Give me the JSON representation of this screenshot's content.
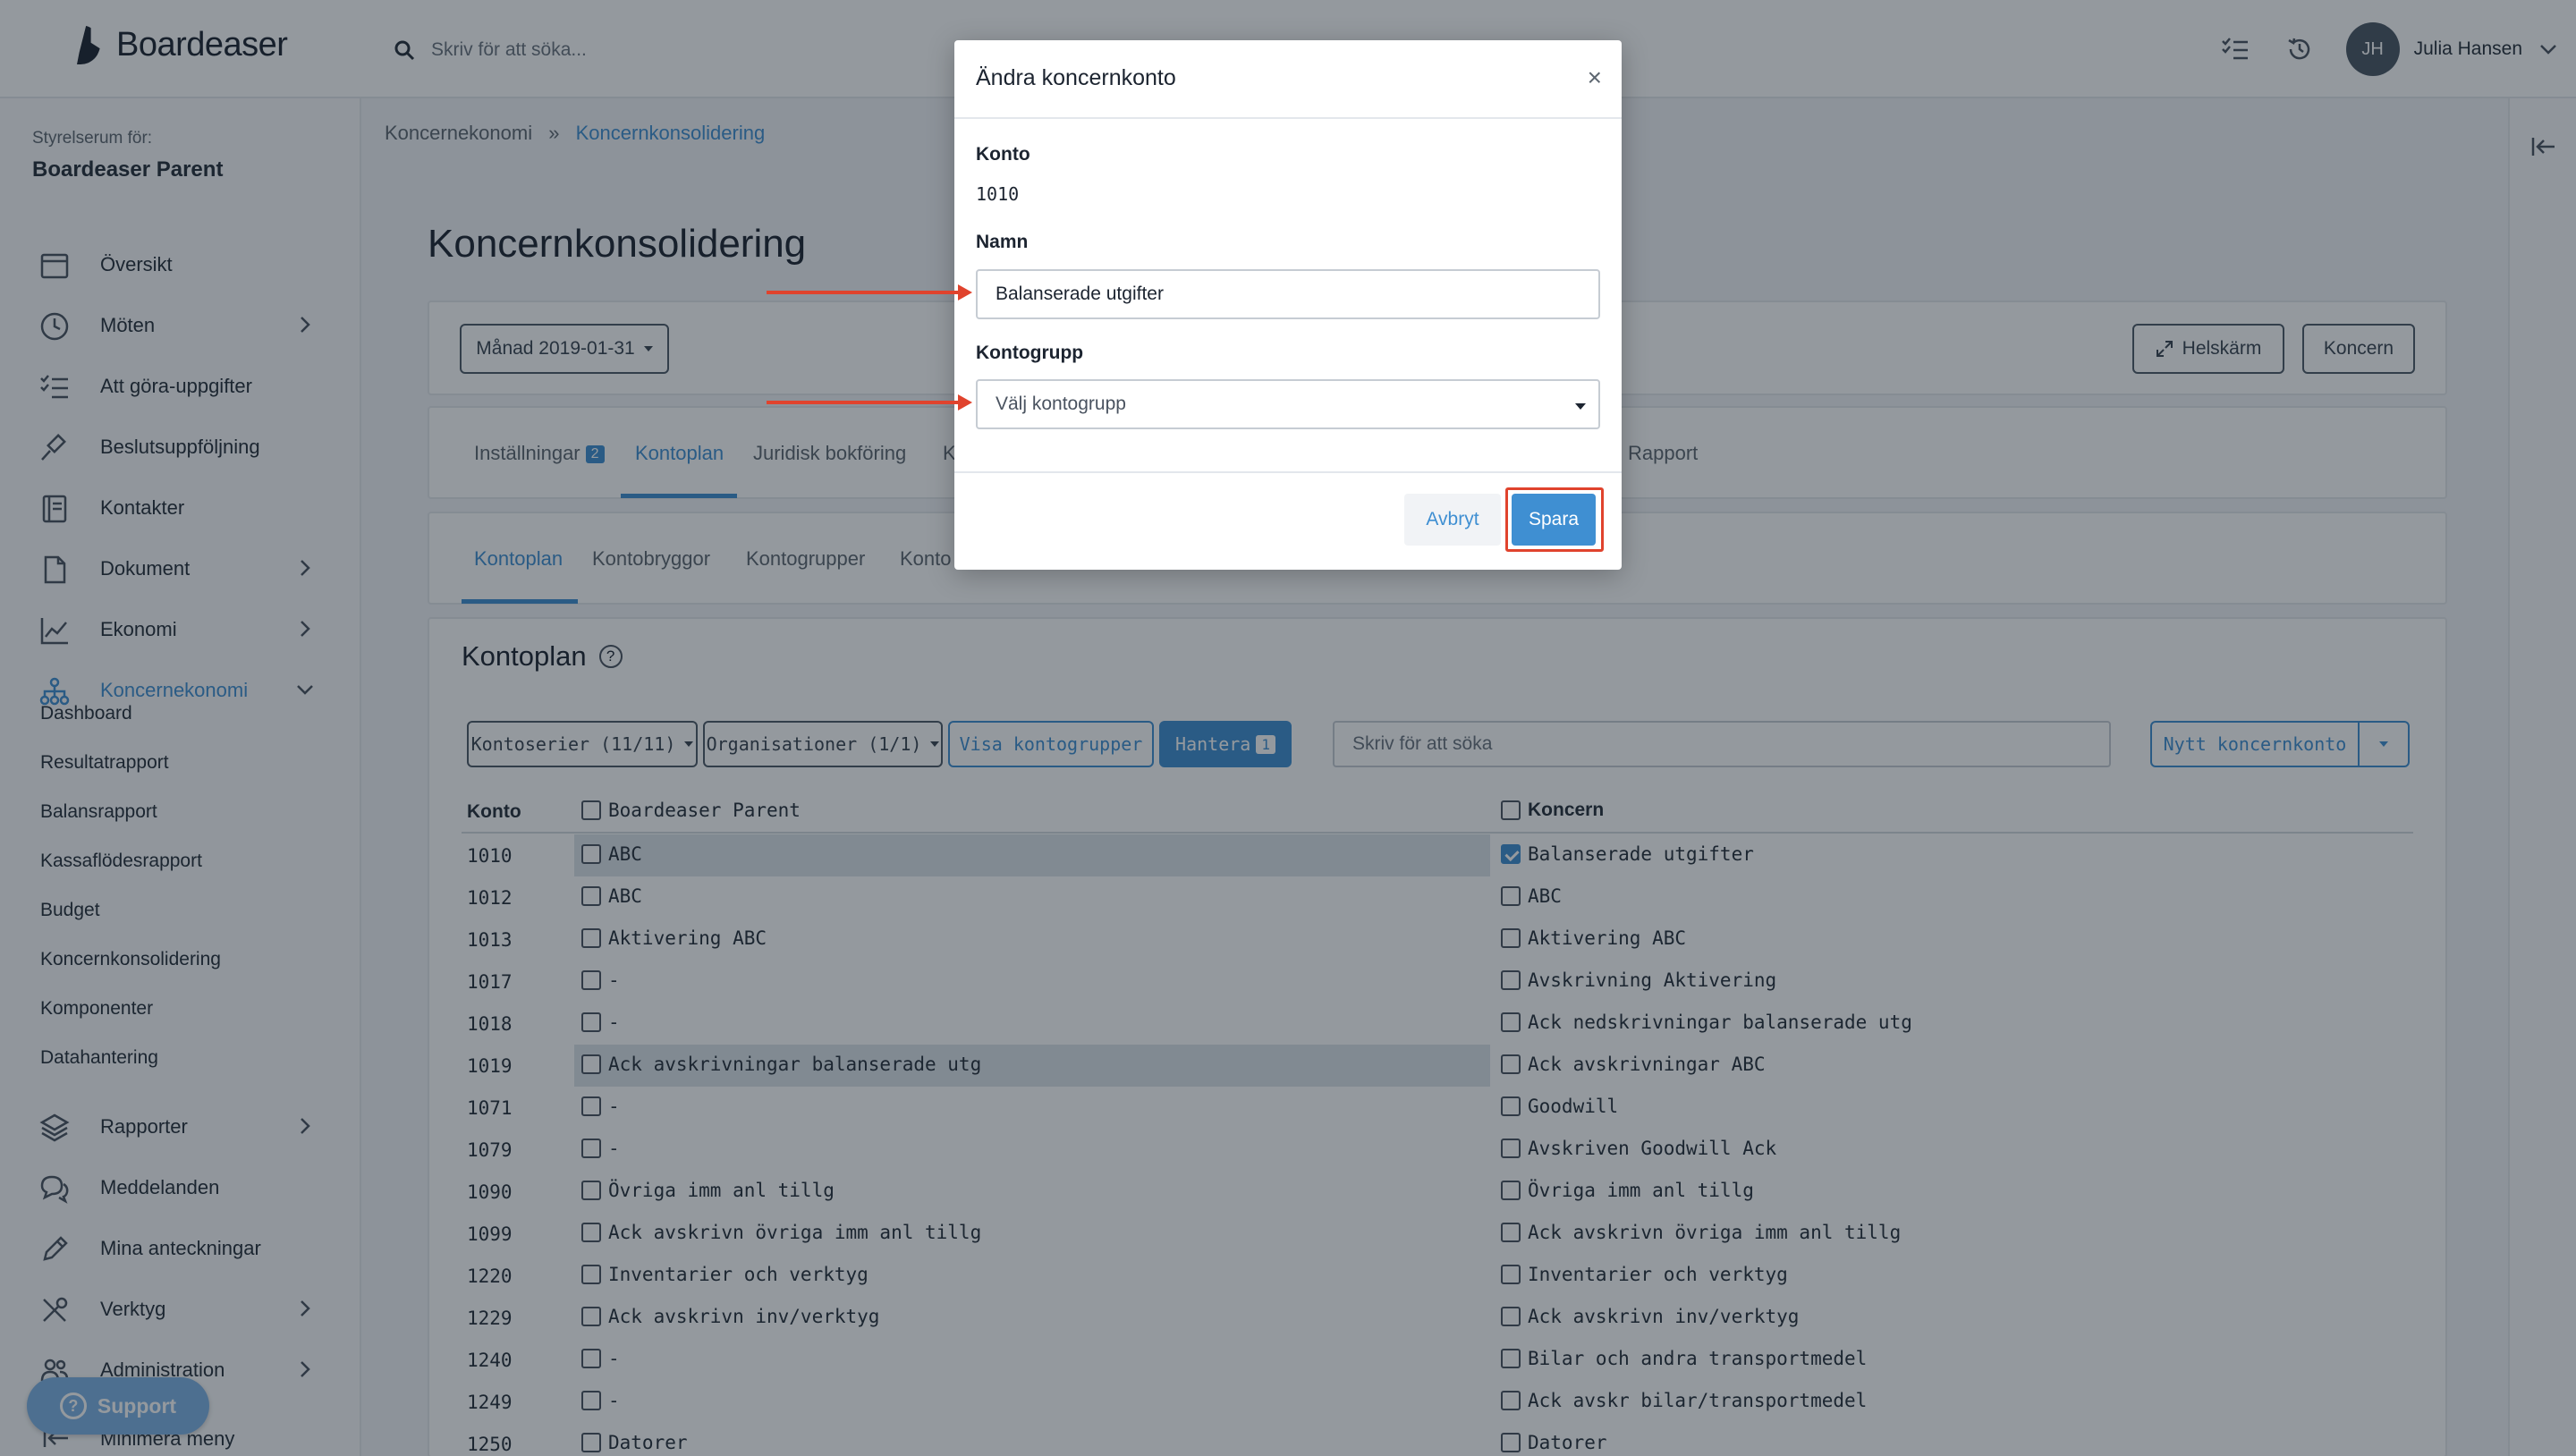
{
  "app": {
    "name": "Boardeaser"
  },
  "search": {
    "placeholder": "Skriv för att söka..."
  },
  "user": {
    "initials": "JH",
    "name": "Julia Hansen"
  },
  "sidebar": {
    "room_label": "Styrelserum för:",
    "room_name": "Boardeaser Parent",
    "items": [
      {
        "label": "Översikt",
        "icon": "calendar-icon"
      },
      {
        "label": "Möten",
        "icon": "clock-icon"
      },
      {
        "label": "Att göra-uppgifter",
        "icon": "checklist-icon"
      },
      {
        "label": "Beslutsuppföljning",
        "icon": "gavel-icon"
      },
      {
        "label": "Kontakter",
        "icon": "address-book-icon"
      },
      {
        "label": "Dokument",
        "icon": "document-icon"
      },
      {
        "label": "Ekonomi",
        "icon": "chart-icon"
      },
      {
        "label": "Koncernekonomi",
        "icon": "org-chart-icon"
      }
    ],
    "subitems": [
      "Dashboard",
      "Resultatrapport",
      "Balansrapport",
      "Kassaflödesrapport",
      "Budget",
      "Koncernkonsolidering",
      "Komponenter",
      "Datahantering"
    ],
    "items2": [
      {
        "label": "Rapporter",
        "icon": "layers-icon"
      },
      {
        "label": "Meddelanden",
        "icon": "chat-icon"
      },
      {
        "label": "Mina anteckningar",
        "icon": "pencil-icon"
      },
      {
        "label": "Verktyg",
        "icon": "tools-icon"
      },
      {
        "label": "Administration",
        "icon": "users-icon"
      }
    ],
    "support": "Support",
    "minimize": "Minimera meny"
  },
  "breadcrumb": {
    "parent": "Koncernekonomi",
    "separator": "»",
    "current": "Koncernkonsolidering"
  },
  "page": {
    "title": "Koncernkonsolidering"
  },
  "toolbar": {
    "period": "Månad 2019-01-31",
    "fullscreen": "Helskärm",
    "koncern": "Koncern"
  },
  "tabs": [
    {
      "label": "Inställningar",
      "badge": "2"
    },
    {
      "label": "Kontoplan"
    },
    {
      "label": "Juridisk bokföring"
    },
    {
      "label": "K"
    },
    {
      "label": "Rapport"
    }
  ],
  "subtabs": [
    "Kontoplan",
    "Kontobryggor",
    "Kontogrupper",
    "Konto"
  ],
  "kontoplan": {
    "title": "Kontoplan",
    "filters": {
      "series": "Kontoserier (11/11)",
      "orgs": "Organisationer (1/1)",
      "show_groups": "Visa kontogrupper",
      "manage": "Hantera",
      "manage_badge": "1"
    },
    "search_placeholder": "Skriv för att söka",
    "new_account": "Nytt koncernkonto",
    "columns": {
      "konto": "Konto",
      "parent": "Boardeaser Parent",
      "koncern": "Koncern"
    },
    "rows": [
      {
        "konto": "1010",
        "parent": "ABC",
        "koncern": "Balanserade utgifter",
        "checked": true,
        "hl": "p"
      },
      {
        "konto": "1012",
        "parent": "ABC",
        "koncern": "ABC"
      },
      {
        "konto": "1013",
        "parent": "Aktivering ABC",
        "koncern": "Aktivering ABC"
      },
      {
        "konto": "1017",
        "parent": "-",
        "koncern": "Avskrivning Aktivering"
      },
      {
        "konto": "1018",
        "parent": "-",
        "koncern": "Ack nedskrivningar balanserade utg"
      },
      {
        "konto": "1019",
        "parent": "Ack avskrivningar balanserade utg",
        "koncern": "Ack avskrivningar ABC",
        "hl": "p"
      },
      {
        "konto": "1071",
        "parent": "-",
        "koncern": "Goodwill"
      },
      {
        "konto": "1079",
        "parent": "-",
        "koncern": "Avskriven Goodwill Ack"
      },
      {
        "konto": "1090",
        "parent": "Övriga imm anl tillg",
        "koncern": "Övriga imm anl tillg"
      },
      {
        "konto": "1099",
        "parent": "Ack avskrivn övriga imm anl tillg",
        "koncern": "Ack avskrivn övriga imm anl tillg"
      },
      {
        "konto": "1220",
        "parent": "Inventarier och verktyg",
        "koncern": "Inventarier och verktyg"
      },
      {
        "konto": "1229",
        "parent": "Ack avskrivn inv/verktyg",
        "koncern": "Ack avskrivn inv/verktyg"
      },
      {
        "konto": "1240",
        "parent": "-",
        "koncern": "Bilar och andra transportmedel"
      },
      {
        "konto": "1249",
        "parent": "-",
        "koncern": "Ack avskr bilar/transportmedel"
      },
      {
        "konto": "1250",
        "parent": "Datorer",
        "koncern": "Datorer"
      }
    ]
  },
  "modal": {
    "title": "Ändra koncernkonto",
    "close": "×",
    "konto_label": "Konto",
    "konto_value": "1010",
    "namn_label": "Namn",
    "namn_value": "Balanserade utgifter",
    "group_label": "Kontogrupp",
    "group_placeholder": "Välj kontogrupp",
    "cancel": "Avbryt",
    "save": "Spara"
  },
  "colors": {
    "accent": "#3f8fd2",
    "annotation": "#e0432d"
  }
}
